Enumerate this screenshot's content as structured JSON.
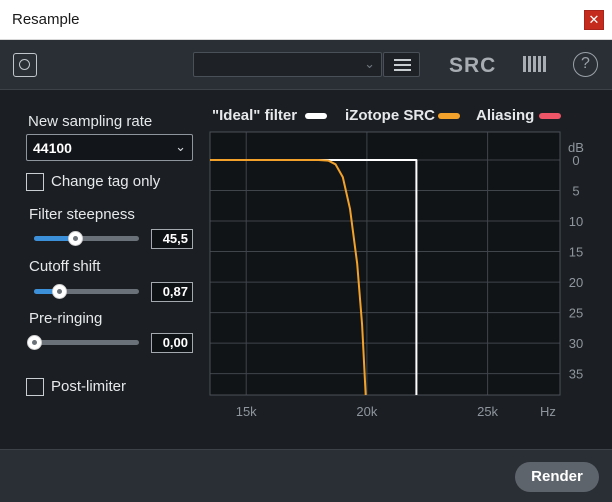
{
  "window": {
    "title": "Resample",
    "close_glyph": "✕"
  },
  "toolbar": {
    "power_icon": "power-icon",
    "preset_value": "",
    "menu_icon": "hamburger-menu-icon",
    "logo_text": "SRC",
    "help_glyph": "?"
  },
  "controls": {
    "sampling_rate_label": "New sampling rate",
    "sampling_rate_value": "44100",
    "change_tag_label": "Change tag only",
    "change_tag_checked": false,
    "filter_steepness_label": "Filter steepness",
    "filter_steepness_value": "45,5",
    "filter_steepness_fraction": 0.39,
    "cutoff_shift_label": "Cutoff shift",
    "cutoff_shift_value": "0,87",
    "cutoff_shift_fraction": 0.24,
    "pre_ringing_label": "Pre-ringing",
    "pre_ringing_value": "0,00",
    "pre_ringing_fraction": 0.0,
    "post_limiter_label": "Post-limiter",
    "post_limiter_checked": false,
    "render_label": "Render"
  },
  "colors": {
    "ideal": "#ffffff",
    "izotope": "#f2a22b",
    "aliasing": "#ee5566",
    "slider_fill": "#3c8fd9",
    "grid": "#3f454b",
    "axis_text": "#8e959c"
  },
  "chart_data": {
    "type": "line",
    "legend": [
      "\"Ideal\" filter",
      "iZotope SRC",
      "Aliasing"
    ],
    "x_tick_labels": [
      "15k",
      "20k",
      "25k"
    ],
    "x_unit": "Hz",
    "xlim": [
      13500,
      28000
    ],
    "y_unit": "dB",
    "y_ticks": [
      0,
      5,
      10,
      15,
      20,
      25,
      30,
      35
    ],
    "ylim": [
      0,
      38.5
    ],
    "y_inverted": true,
    "grid": true,
    "series": [
      {
        "name": "\"Ideal\" filter",
        "color": "ideal",
        "x": [
          13500,
          22050,
          22050
        ],
        "y": [
          0,
          0,
          38.5
        ]
      },
      {
        "name": "iZotope SRC",
        "color": "izotope",
        "x": [
          13500,
          18000,
          18400,
          18700,
          19000,
          19300,
          19600,
          19800,
          19950
        ],
        "y": [
          0,
          0,
          0.1,
          0.7,
          2.8,
          8.0,
          17.0,
          27.0,
          38.5
        ]
      },
      {
        "name": "Aliasing",
        "color": "aliasing",
        "x": [],
        "y": []
      }
    ]
  }
}
